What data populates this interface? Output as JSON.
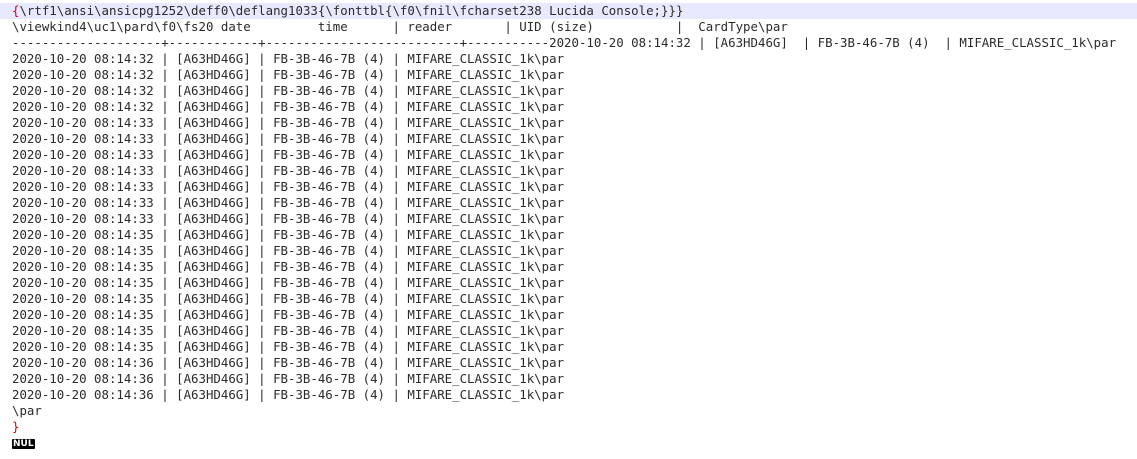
{
  "editor": {
    "header_lines": [
      "\\rtf1\\ansi\\ansicpg1252\\deff0\\deflang1033{\\fonttbl{\\f0\\fnil\\fcharset238 Lucida Console;}}",
      "\\viewkind4\\uc1\\pard\\f0\\fs20 date         time      | reader       | UID (size)           |  CardType\\par",
      "--------------------+------------+--------------------------+-----------2020-10-20 08:14:32 | [A63HD46G]  | FB-3B-46-7B (4)  | MIFARE_CLASSIC_1k\\par"
    ],
    "open_brace": "{",
    "header_first_suffix": "}",
    "log_rows": [
      "2020-10-20 08:14:32 | [A63HD46G] | FB-3B-46-7B (4) | MIFARE_CLASSIC_1k\\par",
      "2020-10-20 08:14:32 | [A63HD46G] | FB-3B-46-7B (4) | MIFARE_CLASSIC_1k\\par",
      "2020-10-20 08:14:32 | [A63HD46G] | FB-3B-46-7B (4) | MIFARE_CLASSIC_1k\\par",
      "2020-10-20 08:14:32 | [A63HD46G] | FB-3B-46-7B (4) | MIFARE_CLASSIC_1k\\par",
      "2020-10-20 08:14:33 | [A63HD46G] | FB-3B-46-7B (4) | MIFARE_CLASSIC_1k\\par",
      "2020-10-20 08:14:33 | [A63HD46G] | FB-3B-46-7B (4) | MIFARE_CLASSIC_1k\\par",
      "2020-10-20 08:14:33 | [A63HD46G] | FB-3B-46-7B (4) | MIFARE_CLASSIC_1k\\par",
      "2020-10-20 08:14:33 | [A63HD46G] | FB-3B-46-7B (4) | MIFARE_CLASSIC_1k\\par",
      "2020-10-20 08:14:33 | [A63HD46G] | FB-3B-46-7B (4) | MIFARE_CLASSIC_1k\\par",
      "2020-10-20 08:14:33 | [A63HD46G] | FB-3B-46-7B (4) | MIFARE_CLASSIC_1k\\par",
      "2020-10-20 08:14:33 | [A63HD46G] | FB-3B-46-7B (4) | MIFARE_CLASSIC_1k\\par",
      "2020-10-20 08:14:35 | [A63HD46G] | FB-3B-46-7B (4) | MIFARE_CLASSIC_1k\\par",
      "2020-10-20 08:14:35 | [A63HD46G] | FB-3B-46-7B (4) | MIFARE_CLASSIC_1k\\par",
      "2020-10-20 08:14:35 | [A63HD46G] | FB-3B-46-7B (4) | MIFARE_CLASSIC_1k\\par",
      "2020-10-20 08:14:35 | [A63HD46G] | FB-3B-46-7B (4) | MIFARE_CLASSIC_1k\\par",
      "2020-10-20 08:14:35 | [A63HD46G] | FB-3B-46-7B (4) | MIFARE_CLASSIC_1k\\par",
      "2020-10-20 08:14:35 | [A63HD46G] | FB-3B-46-7B (4) | MIFARE_CLASSIC_1k\\par",
      "2020-10-20 08:14:35 | [A63HD46G] | FB-3B-46-7B (4) | MIFARE_CLASSIC_1k\\par",
      "2020-10-20 08:14:35 | [A63HD46G] | FB-3B-46-7B (4) | MIFARE_CLASSIC_1k\\par",
      "2020-10-20 08:14:36 | [A63HD46G] | FB-3B-46-7B (4) | MIFARE_CLASSIC_1k\\par",
      "2020-10-20 08:14:36 | [A63HD46G] | FB-3B-46-7B (4) | MIFARE_CLASSIC_1k\\par",
      "2020-10-20 08:14:36 | [A63HD46G] | FB-3B-46-7B (4) | MIFARE_CLASSIC_1k\\par"
    ],
    "tail_par": "\\par",
    "close_brace": "}",
    "nul_marker": "NUL",
    "colors": {
      "current_line_bg": "#e8e8ff",
      "brace": "#e00000",
      "text": "#2b2b2b",
      "nul_bg": "#000000"
    }
  }
}
